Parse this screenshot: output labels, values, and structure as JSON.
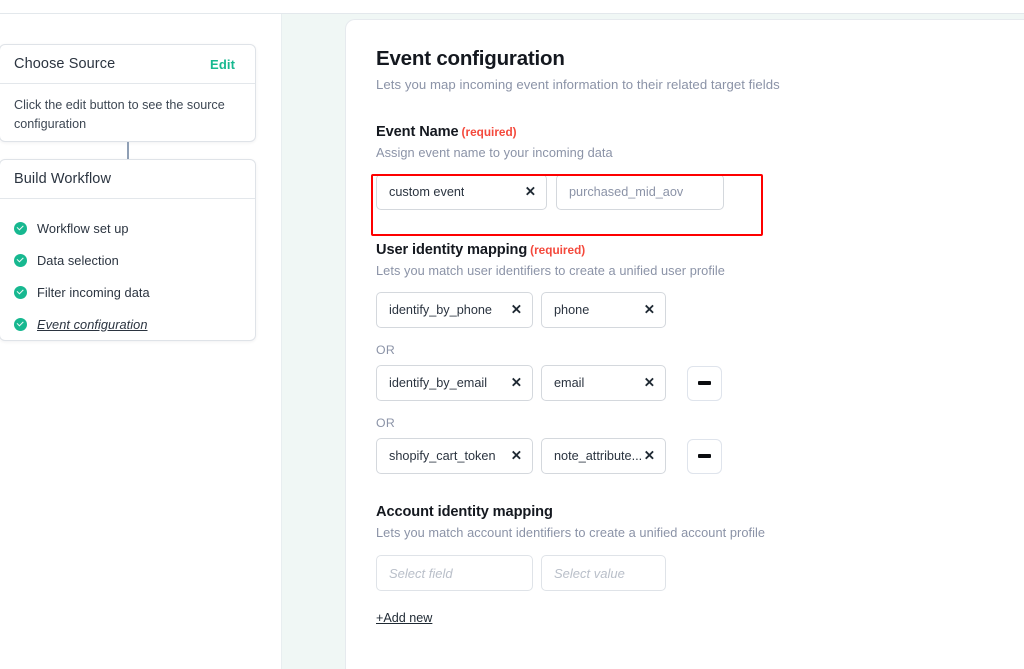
{
  "workflow_sidebar": {
    "choose_source": {
      "title": "Choose Source",
      "edit_label": "Edit",
      "hint": "Click the edit button to see the source configuration"
    },
    "build_workflow": {
      "title": "Build Workflow",
      "steps": [
        {
          "label": "Workflow set up",
          "status": "complete",
          "current": false
        },
        {
          "label": "Data selection",
          "status": "complete",
          "current": false
        },
        {
          "label": "Filter incoming data",
          "status": "complete",
          "current": false
        },
        {
          "label": "Event configuration",
          "status": "complete",
          "current": true
        }
      ]
    }
  },
  "panel": {
    "title": "Event configuration",
    "subtitle": "Lets you map incoming event information to their related target fields",
    "event_name": {
      "heading": "Event Name",
      "required_label": "(required)",
      "description": "Assign event name to your incoming data",
      "field_chip": {
        "text": "custom event",
        "clear_icon": "close-x-icon"
      },
      "value_chip": {
        "text": "purchased_mid_aov"
      }
    },
    "user_identity_mapping": {
      "heading": "User identity mapping",
      "required_label": "(required)",
      "description": "Lets you match user identifiers to create a unified user profile",
      "or_label": "OR",
      "rows": [
        {
          "field": "identify_by_phone",
          "value": "phone",
          "removable": false
        },
        {
          "field": "identify_by_email",
          "value": "email",
          "removable": true
        },
        {
          "field": "shopify_cart_token",
          "value": "note_attribute...",
          "removable": true
        }
      ]
    },
    "account_identity_mapping": {
      "heading": "Account identity mapping",
      "description": "Lets you match account identifiers to create a unified account profile",
      "field_placeholder": "Select field",
      "value_placeholder": "Select value",
      "add_new_label": "+Add new"
    }
  },
  "colors": {
    "accent_green": "#17b890",
    "required_red": "#f4493c",
    "highlight_red": "#fe0000",
    "mint_background": "#f0f7f5",
    "muted_text": "#8b93a7"
  }
}
